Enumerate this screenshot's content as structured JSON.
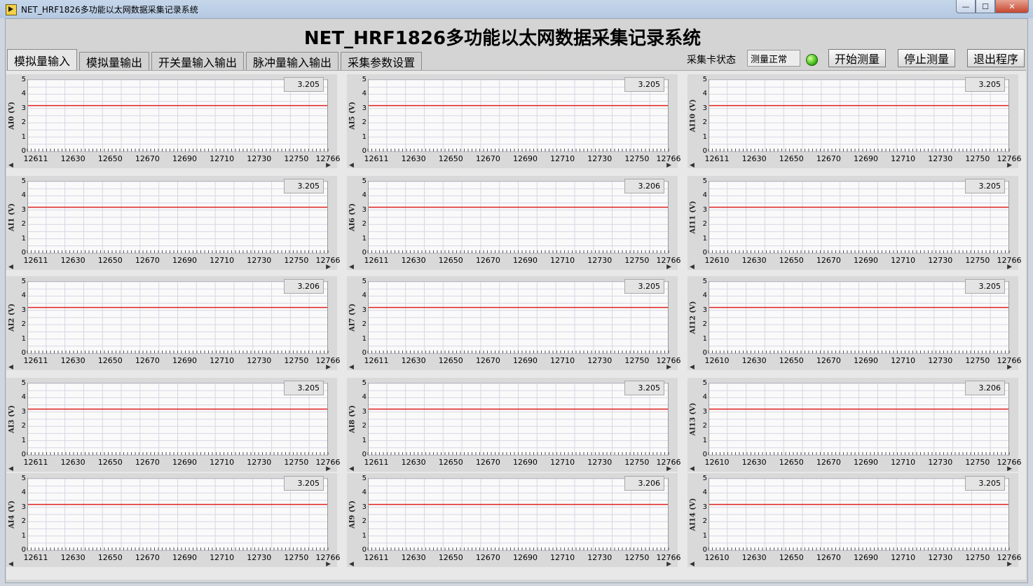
{
  "window": {
    "title": "NET_HRF1826多功能以太网数据采集记录系统",
    "min_glyph": "—",
    "max_glyph": "☐",
    "close_glyph": "✕"
  },
  "header": {
    "title": "NET_HRF1826多功能以太网数据采集记录系统"
  },
  "tabs": [
    {
      "label": "模拟量输入",
      "active": true
    },
    {
      "label": "模拟量输出",
      "active": false
    },
    {
      "label": "开关量输入输出",
      "active": false
    },
    {
      "label": "脉冲量输入输出",
      "active": false
    },
    {
      "label": "采集参数设置",
      "active": false
    }
  ],
  "status": {
    "label": "采集卡状态",
    "value": "测量正常",
    "led_color": "#3fbf1a"
  },
  "buttons": {
    "start": "开始测量",
    "stop": "停止测量",
    "exit": "退出程序"
  },
  "colors": {
    "signal": "#e02020",
    "grid": "#d6d6e6"
  },
  "charts": [
    {
      "ylabel": "AI0 (V)",
      "value": "3.205",
      "xticks": [
        "12611",
        "12630",
        "12650",
        "12670",
        "12690",
        "12710",
        "12730",
        "12750",
        "12766"
      ]
    },
    {
      "ylabel": "AI5 (V)",
      "value": "3.205",
      "xticks": [
        "12611",
        "12630",
        "12650",
        "12670",
        "12690",
        "12710",
        "12730",
        "12750",
        "12766"
      ]
    },
    {
      "ylabel": "AI10 (V)",
      "value": "3.205",
      "xticks": [
        "12611",
        "12630",
        "12650",
        "12670",
        "12690",
        "12710",
        "12730",
        "12750",
        "12766"
      ]
    },
    {
      "ylabel": "AI1 (V)",
      "value": "3.205",
      "xticks": [
        "12611",
        "12630",
        "12650",
        "12670",
        "12690",
        "12710",
        "12730",
        "12750",
        "12766"
      ]
    },
    {
      "ylabel": "AI6 (V)",
      "value": "3.206",
      "xticks": [
        "12611",
        "12630",
        "12650",
        "12670",
        "12690",
        "12710",
        "12730",
        "12750",
        "12766"
      ]
    },
    {
      "ylabel": "AI11 (V)",
      "value": "3.205",
      "xticks": [
        "12610",
        "12630",
        "12650",
        "12670",
        "12690",
        "12710",
        "12730",
        "12750",
        "12766"
      ]
    },
    {
      "ylabel": "AI2 (V)",
      "value": "3.206",
      "xticks": [
        "12611",
        "12630",
        "12650",
        "12670",
        "12690",
        "12710",
        "12730",
        "12750",
        "12766"
      ]
    },
    {
      "ylabel": "AI7 (V)",
      "value": "3.205",
      "xticks": [
        "12611",
        "12630",
        "12650",
        "12670",
        "12690",
        "12710",
        "12730",
        "12750",
        "12766"
      ]
    },
    {
      "ylabel": "AI12 (V)",
      "value": "3.205",
      "xticks": [
        "12610",
        "12630",
        "12650",
        "12670",
        "12690",
        "12710",
        "12730",
        "12750",
        "12766"
      ]
    },
    {
      "ylabel": "AI3 (V)",
      "value": "3.205",
      "xticks": [
        "12611",
        "12630",
        "12650",
        "12670",
        "12690",
        "12710",
        "12730",
        "12750",
        "12766"
      ]
    },
    {
      "ylabel": "AI8 (V)",
      "value": "3.205",
      "xticks": [
        "12611",
        "12630",
        "12650",
        "12670",
        "12690",
        "12710",
        "12730",
        "12750",
        "12766"
      ]
    },
    {
      "ylabel": "AI13 (V)",
      "value": "3.206",
      "xticks": [
        "12610",
        "12630",
        "12650",
        "12670",
        "12690",
        "12710",
        "12730",
        "12750",
        "12766"
      ]
    },
    {
      "ylabel": "AI4 (V)",
      "value": "3.205",
      "xticks": [
        "12611",
        "12630",
        "12650",
        "12670",
        "12690",
        "12710",
        "12730",
        "12750",
        "12766"
      ]
    },
    {
      "ylabel": "AI9 (V)",
      "value": "3.206",
      "xticks": [
        "12611",
        "12630",
        "12650",
        "12670",
        "12690",
        "12710",
        "12730",
        "12750",
        "12766"
      ]
    },
    {
      "ylabel": "AI14 (V)",
      "value": "3.205",
      "xticks": [
        "12610",
        "12630",
        "12650",
        "12670",
        "12690",
        "12710",
        "12730",
        "12750",
        "12766"
      ]
    }
  ],
  "chart_data": [
    {
      "type": "line",
      "ylabel": "AI0 (V)",
      "ylim": [
        0,
        5
      ],
      "yticks": [
        "0",
        "1",
        "2",
        "3",
        "4",
        "5"
      ],
      "xlim": [
        12611,
        12766
      ],
      "series": [
        {
          "values": [
            3.205
          ]
        }
      ]
    },
    {
      "type": "line",
      "ylabel": "AI5 (V)",
      "ylim": [
        0,
        5
      ],
      "yticks": [
        "0",
        "1",
        "2",
        "3",
        "4",
        "5"
      ],
      "xlim": [
        12611,
        12766
      ],
      "series": [
        {
          "values": [
            3.205
          ]
        }
      ]
    },
    {
      "type": "line",
      "ylabel": "AI10 (V)",
      "ylim": [
        0,
        5
      ],
      "yticks": [
        "0",
        "1",
        "2",
        "3",
        "4",
        "5"
      ],
      "xlim": [
        12611,
        12766
      ],
      "series": [
        {
          "values": [
            3.205
          ]
        }
      ]
    },
    {
      "type": "line",
      "ylabel": "AI1 (V)",
      "ylim": [
        0,
        5
      ],
      "yticks": [
        "0",
        "1",
        "2",
        "3",
        "4",
        "5"
      ],
      "xlim": [
        12611,
        12766
      ],
      "series": [
        {
          "values": [
            3.205
          ]
        }
      ]
    },
    {
      "type": "line",
      "ylabel": "AI6 (V)",
      "ylim": [
        0,
        5
      ],
      "yticks": [
        "0",
        "1",
        "2",
        "3",
        "4",
        "5"
      ],
      "xlim": [
        12611,
        12766
      ],
      "series": [
        {
          "values": [
            3.206
          ]
        }
      ]
    },
    {
      "type": "line",
      "ylabel": "AI11 (V)",
      "ylim": [
        0,
        5
      ],
      "yticks": [
        "0",
        "1",
        "2",
        "3",
        "4",
        "5"
      ],
      "xlim": [
        12610,
        12766
      ],
      "series": [
        {
          "values": [
            3.205
          ]
        }
      ]
    },
    {
      "type": "line",
      "ylabel": "AI2 (V)",
      "ylim": [
        0,
        5
      ],
      "yticks": [
        "0",
        "1",
        "2",
        "3",
        "4",
        "5"
      ],
      "xlim": [
        12611,
        12766
      ],
      "series": [
        {
          "values": [
            3.206
          ]
        }
      ]
    },
    {
      "type": "line",
      "ylabel": "AI7 (V)",
      "ylim": [
        0,
        5
      ],
      "yticks": [
        "0",
        "1",
        "2",
        "3",
        "4",
        "5"
      ],
      "xlim": [
        12611,
        12766
      ],
      "series": [
        {
          "values": [
            3.205
          ]
        }
      ]
    },
    {
      "type": "line",
      "ylabel": "AI12 (V)",
      "ylim": [
        0,
        5
      ],
      "yticks": [
        "0",
        "1",
        "2",
        "3",
        "4",
        "5"
      ],
      "xlim": [
        12610,
        12766
      ],
      "series": [
        {
          "values": [
            3.205
          ]
        }
      ]
    },
    {
      "type": "line",
      "ylabel": "AI3 (V)",
      "ylim": [
        0,
        5
      ],
      "yticks": [
        "0",
        "1",
        "2",
        "3",
        "4",
        "5"
      ],
      "xlim": [
        12611,
        12766
      ],
      "series": [
        {
          "values": [
            3.205
          ]
        }
      ]
    },
    {
      "type": "line",
      "ylabel": "AI8 (V)",
      "ylim": [
        0,
        5
      ],
      "yticks": [
        "0",
        "1",
        "2",
        "3",
        "4",
        "5"
      ],
      "xlim": [
        12611,
        12766
      ],
      "series": [
        {
          "values": [
            3.205
          ]
        }
      ]
    },
    {
      "type": "line",
      "ylabel": "AI13 (V)",
      "ylim": [
        0,
        5
      ],
      "yticks": [
        "0",
        "1",
        "2",
        "3",
        "4",
        "5"
      ],
      "xlim": [
        12610,
        12766
      ],
      "series": [
        {
          "values": [
            3.206
          ]
        }
      ]
    },
    {
      "type": "line",
      "ylabel": "AI4 (V)",
      "ylim": [
        0,
        5
      ],
      "yticks": [
        "0",
        "1",
        "2",
        "3",
        "4",
        "5"
      ],
      "xlim": [
        12611,
        12766
      ],
      "series": [
        {
          "values": [
            3.205
          ]
        }
      ]
    },
    {
      "type": "line",
      "ylabel": "AI9 (V)",
      "ylim": [
        0,
        5
      ],
      "yticks": [
        "0",
        "1",
        "2",
        "3",
        "4",
        "5"
      ],
      "xlim": [
        12611,
        12766
      ],
      "series": [
        {
          "values": [
            3.206
          ]
        }
      ]
    },
    {
      "type": "line",
      "ylabel": "AI14 (V)",
      "ylim": [
        0,
        5
      ],
      "yticks": [
        "0",
        "1",
        "2",
        "3",
        "4",
        "5"
      ],
      "xlim": [
        12610,
        12766
      ],
      "series": [
        {
          "values": [
            3.205
          ]
        }
      ]
    }
  ]
}
